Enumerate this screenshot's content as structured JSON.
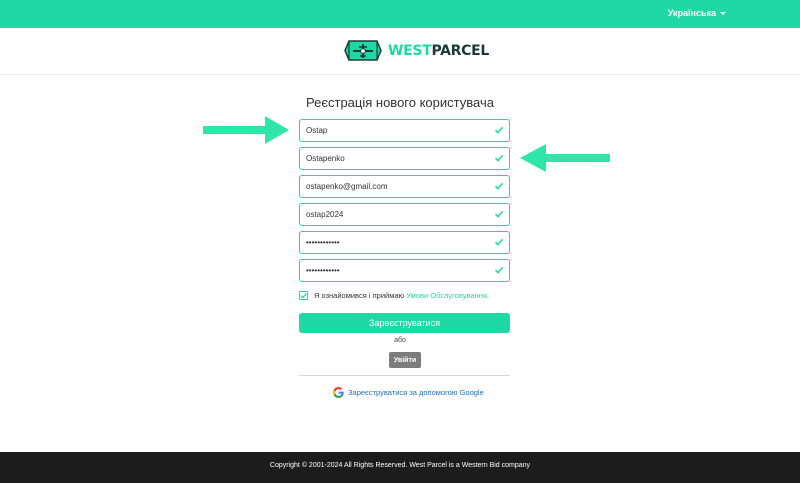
{
  "topbar": {
    "language": "Українська",
    "accent": "#1ed9a4"
  },
  "logo": {
    "prefix": "WEST",
    "suffix": "PARCEL",
    "icon": "airplane-box-icon"
  },
  "form": {
    "title": "Реєстрація нового користувача",
    "first_name": "Ostap",
    "last_name": "Ostapenko",
    "email": "ostapenko@gmail.com",
    "username": "ostap2024",
    "password": "••••••••••••",
    "password_confirm": "••••••••••••",
    "terms_text": "Я ознайомився і приймаю",
    "terms_link": "Умови Обслуговування.",
    "terms_checked": true,
    "register_label": "Зареєструватися",
    "or_label": "або",
    "login_label": "Увійти",
    "google_label": "Зареєструватися за допомогою Google"
  },
  "footer": {
    "copyright": "Copyright © 2001-2024 All Rights Reserved. West Parcel is a Western Bid company"
  },
  "annotations": {
    "arrow_color": "#2ee6a8"
  }
}
